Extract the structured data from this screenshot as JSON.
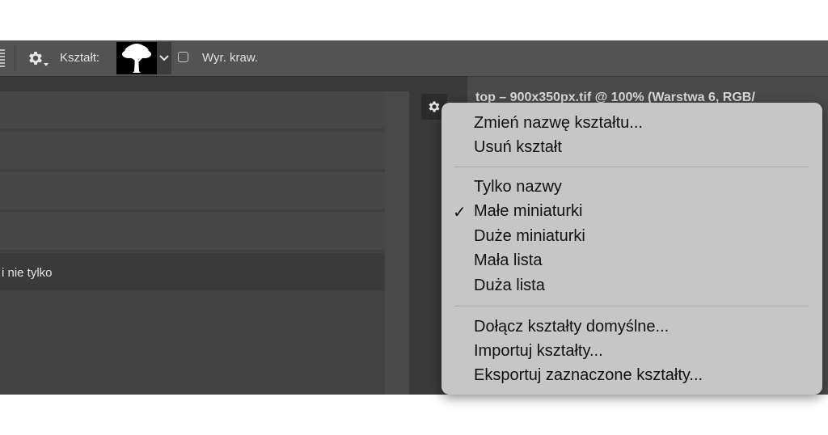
{
  "optbar": {
    "shape_label": "Kształt:",
    "checkbox_label": "Wyr. kraw.",
    "checkbox_checked": false
  },
  "panel": {
    "rows": [
      {
        "label": ""
      },
      {
        "label": ""
      },
      {
        "label": ""
      },
      {
        "label": ""
      },
      {
        "label": "i nie tylko"
      }
    ]
  },
  "document_tab": "top – 900x350px.tif @ 100% (Warstwa 6, RGB/",
  "context_menu": {
    "group1": [
      "Zmień nazwę kształtu...",
      "Usuń kształt"
    ],
    "group2": [
      {
        "label": "Tylko nazwy",
        "checked": false
      },
      {
        "label": "Małe miniaturki",
        "checked": true
      },
      {
        "label": "Duże miniaturki",
        "checked": false
      },
      {
        "label": "Mała lista",
        "checked": false
      },
      {
        "label": "Duża lista",
        "checked": false
      }
    ],
    "group3": [
      "Dołącz kształty domyślne...",
      "Importuj kształty...",
      "Eksportuj zaznaczone kształty..."
    ],
    "checkmark": "✓"
  },
  "icons": [
    "gear-icon",
    "tree-shape-icon",
    "chevron-down-icon",
    "checkbox-icon",
    "panel-settings-gear-icon",
    "checkmark-icon"
  ]
}
